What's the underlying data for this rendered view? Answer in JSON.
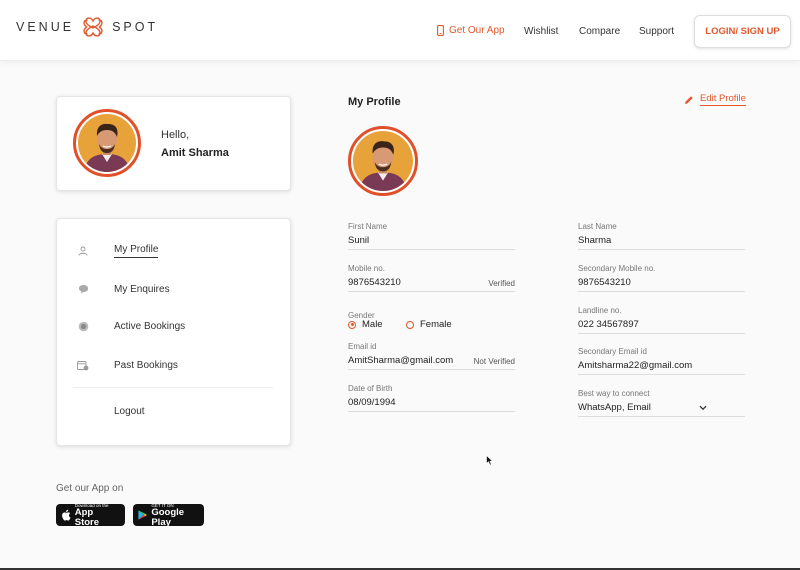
{
  "header": {
    "logo_left": "VENUE",
    "logo_right": "SPOT",
    "nav": {
      "get_app": "Get Our App",
      "wishlist": "Wishlist",
      "compare": "Compare",
      "support": "Support"
    },
    "login_label": "LOGIN/ SIGN UP"
  },
  "sidebar": {
    "greeting": "Hello,",
    "user_name": "Amit Sharma",
    "menu": [
      {
        "label": "My Profile",
        "icon": "user-icon",
        "active": true
      },
      {
        "label": "My Enquires",
        "icon": "chat-bubble-icon",
        "active": false
      },
      {
        "label": "Active Bookings",
        "icon": "active-booking-icon",
        "active": false
      },
      {
        "label": "Past Bookings",
        "icon": "calendar-clock-icon",
        "active": false
      },
      {
        "label": "Logout",
        "icon": "",
        "active": false
      }
    ],
    "get_app_text": "Get our App on",
    "app_store": {
      "small": "Download on the",
      "big": "App Store"
    },
    "google_play": {
      "small": "GET IT ON",
      "big": "Google Play"
    }
  },
  "profile": {
    "title": "My Profile",
    "edit_label": "Edit Profile",
    "fields": {
      "first_name": {
        "label": "First Name",
        "value": "Sunil"
      },
      "last_name": {
        "label": "Last Name",
        "value": "Sharma"
      },
      "mobile": {
        "label": "Mobile no.",
        "value": "9876543210",
        "status": "Verified"
      },
      "secondary_mobile": {
        "label": "Secondary Mobile no.",
        "value": "9876543210"
      },
      "gender": {
        "label": "Gender",
        "options": [
          "Male",
          "Female"
        ],
        "selected": "Male"
      },
      "landline": {
        "label": "Landline no.",
        "value": "022 34567897"
      },
      "email": {
        "label": "Email id",
        "value": "AmitSharma@gmail.com",
        "status": "Not Verified"
      },
      "secondary_email": {
        "label": "Secondary Email id",
        "value": "Amitsharma22@gmail.com"
      },
      "dob": {
        "label": "Date of Birth",
        "value": "08/09/1994"
      },
      "connect": {
        "label": "Best way to connect",
        "value": "WhatsApp, Email"
      }
    }
  },
  "colors": {
    "accent": "#e2572d",
    "avatar_bg": "#e8a23a"
  }
}
